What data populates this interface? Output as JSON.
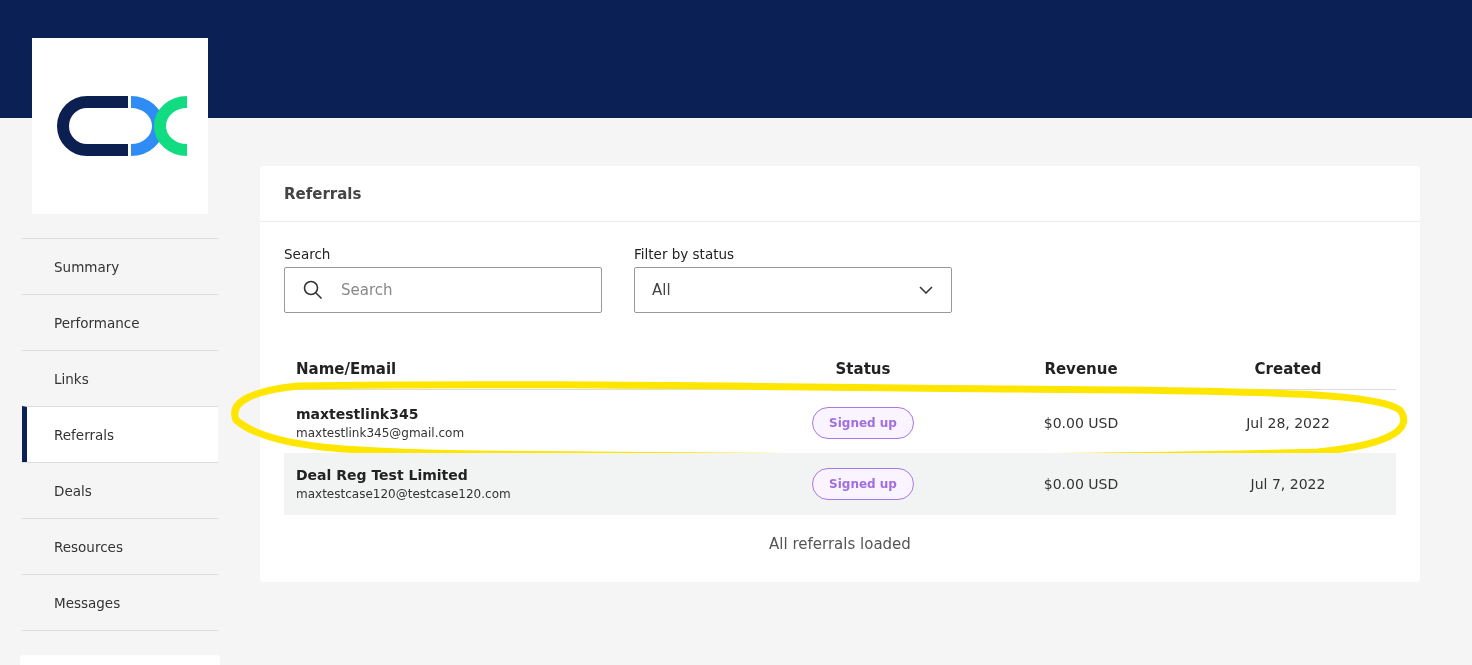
{
  "sidebar": {
    "items": [
      {
        "label": "Summary",
        "selected": false
      },
      {
        "label": "Performance",
        "selected": false
      },
      {
        "label": "Links",
        "selected": false
      },
      {
        "label": "Referrals",
        "selected": true
      },
      {
        "label": "Deals",
        "selected": false
      },
      {
        "label": "Resources",
        "selected": false
      },
      {
        "label": "Messages",
        "selected": false
      }
    ]
  },
  "card": {
    "title": "Referrals",
    "search": {
      "label": "Search",
      "placeholder": "Search"
    },
    "filter": {
      "label": "Filter by status",
      "value": "All"
    },
    "table": {
      "columns": [
        "Name/Email",
        "Status",
        "Revenue",
        "Created"
      ],
      "rows": [
        {
          "name": "maxtestlink345",
          "email": "maxtestlink345@gmail.com",
          "status": "Signed up",
          "revenue": "$0.00 USD",
          "created": "Jul 28, 2022",
          "highlighted": true
        },
        {
          "name": "Deal Reg Test Limited",
          "email": "maxtestcase120@testcase120.com",
          "status": "Signed up",
          "revenue": "$0.00 USD",
          "created": "Jul 7, 2022",
          "highlighted": false
        }
      ]
    },
    "footer": "All referrals loaded"
  }
}
